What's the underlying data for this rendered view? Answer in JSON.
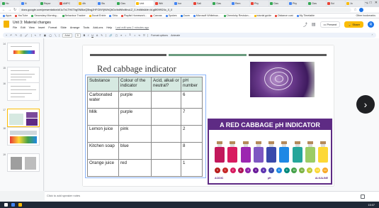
{
  "browser": {
    "tabs": [
      {
        "label": "Ho",
        "color": "#34a853"
      },
      {
        "label": "N",
        "color": "#4285f4"
      },
      {
        "label": "Repor",
        "color": "#34a853"
      },
      {
        "label": "AMPC",
        "color": "#ea4335"
      },
      {
        "label": "4th",
        "color": "#fbbc04"
      },
      {
        "label": "Stu",
        "color": "#4285f4"
      },
      {
        "label": "Clas",
        "color": "#34a853"
      },
      {
        "label": "Unit",
        "color": "#fbbc04"
      },
      {
        "label": "Whi",
        "color": "#ea4335"
      },
      {
        "label": "hor",
        "color": "#4285f4"
      },
      {
        "label": "Sali",
        "color": "#ea4335"
      },
      {
        "label": "Clas",
        "color": "#34a853"
      },
      {
        "label": "Rem",
        "color": "#4285f4"
      },
      {
        "label": "Phy",
        "color": "#ea4335"
      },
      {
        "label": "Clas",
        "color": "#34a853"
      },
      {
        "label": "Phy",
        "color": "#4285f4"
      },
      {
        "label": "Clas",
        "color": "#34a853"
      },
      {
        "label": "Sci",
        "color": "#ea4335"
      },
      {
        "label": "Jo",
        "color": "#fbbc04"
      }
    ],
    "url": "docs.google.com/presentation/d/1uTxLTH4TbgSN8kzQ5bqjJHFGiNYjtWhQbDz4stWbdtlnuLZ_0-/edit#slide=id.g8f09f924c_0_0",
    "bookmarks": [
      {
        "label": "Apps",
        "color": "#4285f4"
      },
      {
        "label": "YouTube",
        "color": "#ea4335"
      },
      {
        "label": "Secondary Morning...",
        "color": "#34a853"
      },
      {
        "label": "Behaviour Tracker",
        "color": "#34a853"
      },
      {
        "label": "Ducat Entrie",
        "color": "#fbbc04"
      },
      {
        "label": "Stria",
        "color": "#4285f4"
      },
      {
        "label": "Playlist Homework...",
        "color": "#ea4335"
      },
      {
        "label": "Canvas",
        "color": "#ea4335"
      },
      {
        "label": "Spokes",
        "color": "#4285f4"
      },
      {
        "label": "Zoom",
        "color": "#1a73e8"
      },
      {
        "label": "Microsoft Whiteboa...",
        "color": "#4285f4"
      },
      {
        "label": "Chemistry Revision...",
        "color": "#34a853"
      },
      {
        "label": "tutorial guide",
        "color": "#fbbc04"
      },
      {
        "label": "Distance cust",
        "color": "#ea4335"
      },
      {
        "label": "My Timetable",
        "color": "#4285f4"
      }
    ],
    "other_bookmarks": "Other bookmarks"
  },
  "slides": {
    "title": "Unit 3: Material changes",
    "menu": [
      "File",
      "Edit",
      "View",
      "Insert",
      "Format",
      "Slide",
      "Arrange",
      "Tools",
      "Add-ons",
      "Help"
    ],
    "last_edit": "Last edit was 2 minutes ago",
    "present": "Present",
    "share": "Share",
    "avatar": "R",
    "toolbar": {
      "font": "Arial",
      "size": "9",
      "format_options": "Format options",
      "animate": "Animate"
    }
  },
  "filmstrip": {
    "numbers": [
      "14",
      "15",
      "16",
      "17",
      "18",
      "19"
    ]
  },
  "slide": {
    "title": "Red cabbage indicator",
    "table": {
      "headers": [
        "Substance",
        "Colour of the indicator",
        "Acid, alkali or neutral?",
        "pH number"
      ],
      "rows": [
        [
          "Carbonated water",
          "purple",
          "",
          "6"
        ],
        [
          "Milk",
          "purple",
          "",
          "7"
        ],
        [
          "Lemon juice",
          "pink",
          "",
          "2"
        ],
        [
          "Kitchen soap",
          "blue",
          "",
          "8"
        ],
        [
          "Orange juice",
          "red",
          "",
          "1"
        ]
      ]
    },
    "infographic": {
      "title": "A RED CABBAGE pH INDICATOR",
      "bottle_colors": [
        "#c2185b",
        "#d81b60",
        "#9c27b0",
        "#7e57c2",
        "#3949ab",
        "#1e88e5",
        "#26a69a",
        "#9ccc65",
        "#fdd835"
      ],
      "scale": [
        "0",
        "1",
        "2",
        "3",
        "4",
        "5",
        "6",
        "7",
        "8",
        "9",
        "10",
        "11",
        "12",
        "13",
        "14"
      ],
      "scale_colors": [
        "#b71c1c",
        "#c62828",
        "#d81b60",
        "#ad1457",
        "#8e24aa",
        "#6a1b9a",
        "#5e35b1",
        "#3949ab",
        "#1e88e5",
        "#00897b",
        "#43a047",
        "#7cb342",
        "#c0ca33",
        "#fdd835",
        "#f9a825"
      ],
      "labels": {
        "left": "ACIDIC",
        "mid": "pH",
        "right": "ALKALINE"
      }
    }
  },
  "notes": {
    "placeholder": "Click to add speaker notes"
  },
  "taskbar": {
    "time": "15:07"
  }
}
